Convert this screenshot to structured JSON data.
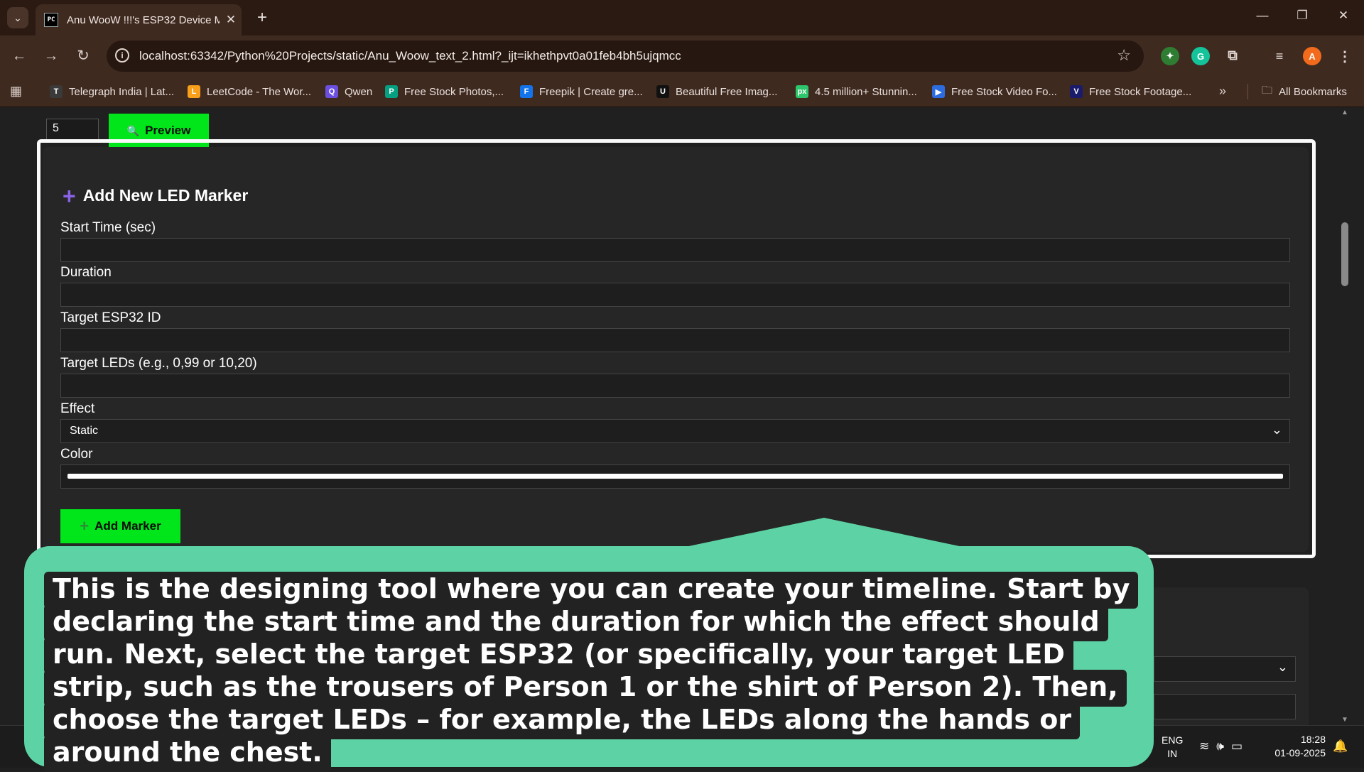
{
  "browser": {
    "tab_title": "Anu WooW !!!'s ESP32 Device M",
    "favicon_text": "PC",
    "url": "localhost:63342/Python%20Projects/static/Anu_Woow_text_2.html?_ijt=ikhethpvt0a01feb4bh5ujqmcc",
    "profile_initial": "A",
    "bookmarks": [
      {
        "label": "Telegraph India | Lat...",
        "icon": "telegraph-icon",
        "color": "#3a3a3a",
        "glyph": "T"
      },
      {
        "label": "LeetCode - The Wor...",
        "icon": "leetcode-icon",
        "color": "#f89f1b",
        "glyph": "L"
      },
      {
        "label": "Qwen",
        "icon": "qwen-icon",
        "color": "#6b4fe0",
        "glyph": "Q"
      },
      {
        "label": "Free Stock Photos,...",
        "icon": "pexels-icon",
        "color": "#05a081",
        "glyph": "P"
      },
      {
        "label": "Freepik | Create gre...",
        "icon": "freepik-icon",
        "color": "#1273eb",
        "glyph": "F"
      },
      {
        "label": "Beautiful Free Imag...",
        "icon": "unsplash-icon",
        "color": "#111111",
        "glyph": "U"
      },
      {
        "label": "4.5 million+ Stunnin...",
        "icon": "pixabay-icon",
        "color": "#2ec66d",
        "glyph": "px"
      },
      {
        "label": "Free Stock Video Fo...",
        "icon": "video-icon",
        "color": "#2d6cdf",
        "glyph": "▶"
      },
      {
        "label": "Free Stock Footage...",
        "icon": "videvo-icon",
        "color": "#1b1b6b",
        "glyph": "V"
      }
    ],
    "all_bookmarks": "All Bookmarks"
  },
  "toolbar": {
    "duration_value": "5",
    "preview_label": "Preview"
  },
  "form": {
    "title": "Add New LED Marker",
    "start_time_label": "Start Time (sec)",
    "duration_label": "Duration",
    "target_esp_label": "Target ESP32 ID",
    "target_leds_label": "Target LEDs (e.g., 0,99 or 10,20)",
    "effect_label": "Effect",
    "effect_value": "Static",
    "color_label": "Color",
    "color_value": "#ffffff",
    "add_button": "Add Marker"
  },
  "accent_colors": {
    "green_button": "#00e61a",
    "callout_bg": "#5dd3a5",
    "plus_icon": "#8b63e8"
  },
  "callout": {
    "text": "This is the designing tool where you can create your timeline. Start by declaring the start time and the duration for which the effect should run. Next, select the target ESP32 (or specifically, your target LED strip, such as the trousers of Person 1 or the shirt of Person 2). Then, choose the target LEDs – for example, the LEDs along the hands or around the chest."
  },
  "taskbar": {
    "lang_line1": "ENG",
    "lang_line2": "IN",
    "time": "18:28",
    "date": "01-09-2025"
  }
}
